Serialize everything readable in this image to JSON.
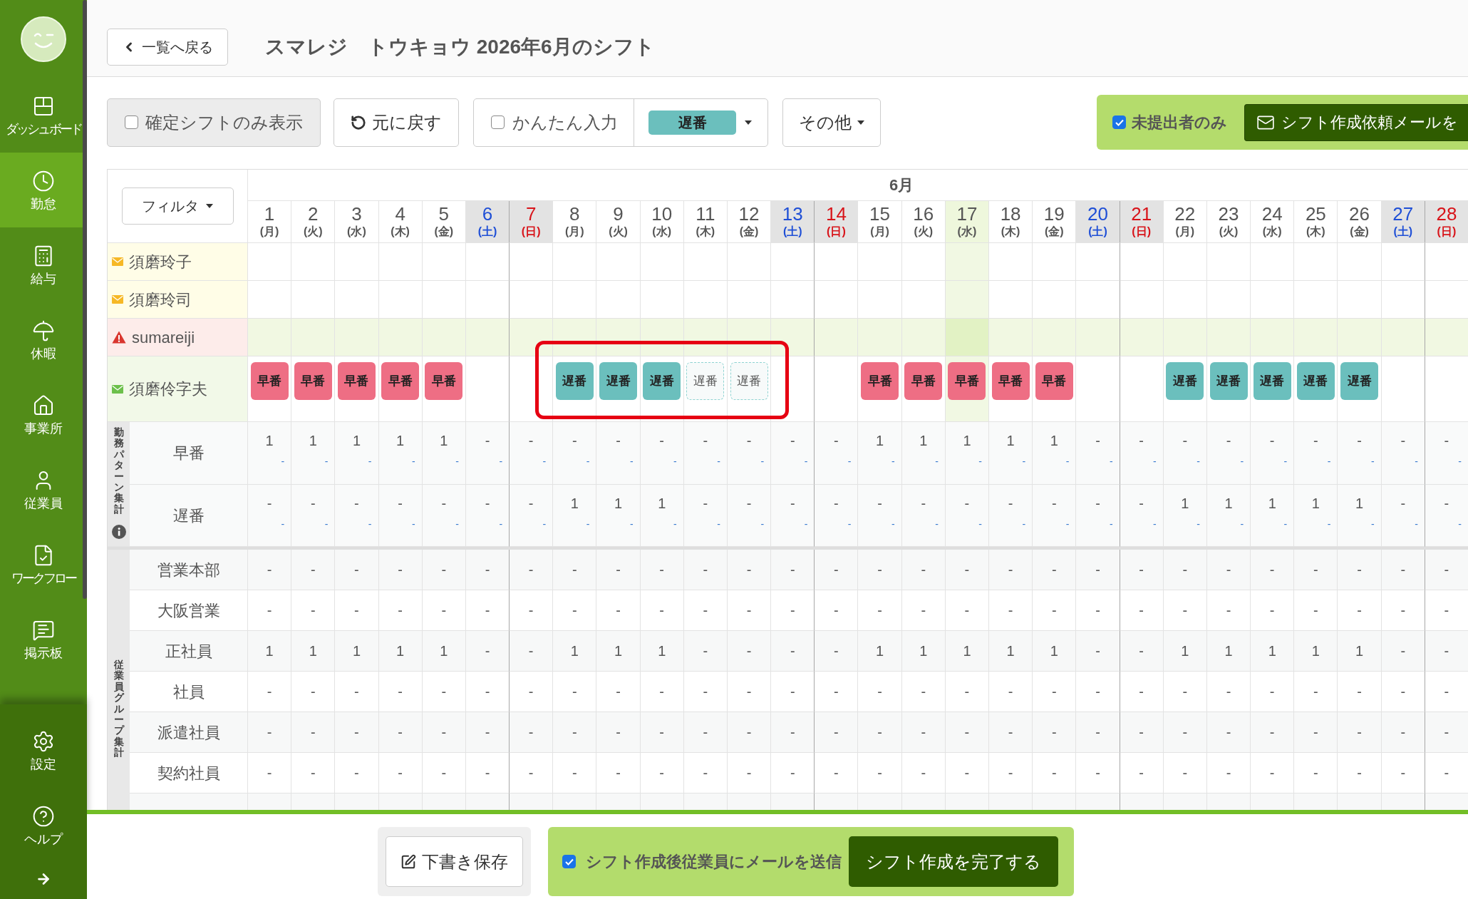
{
  "sidebar": {
    "items": [
      {
        "label": "ダッシュボード",
        "selected": false
      },
      {
        "label": "勤怠",
        "selected": true
      },
      {
        "label": "給与",
        "selected": false
      },
      {
        "label": "休暇",
        "selected": false
      },
      {
        "label": "事業所",
        "selected": false
      },
      {
        "label": "従業員",
        "selected": false
      },
      {
        "label": "ワークフロー",
        "selected": false
      },
      {
        "label": "掲示板",
        "selected": false
      }
    ],
    "bottom_items": [
      "設定",
      "ヘルプ"
    ]
  },
  "header": {
    "back_button": "一覧へ戻る",
    "title": "スマレジ　トウキョウ 2026年6月のシフト"
  },
  "toolbar": {
    "confirmed_only": {
      "label": "確定シフトのみ表示",
      "checked": false
    },
    "undo_button": "元に戻す",
    "quick_input": {
      "label": "かんたん入力",
      "checked": false,
      "pattern": "遅番"
    },
    "other_menu": "その他",
    "unsubmitted_only": {
      "label": "未提出者のみ",
      "checked": true
    },
    "request_mail_button": "シフト作成依頼メールを"
  },
  "calendar": {
    "filter_button": "フィルタ",
    "month": "6月",
    "days": [
      {
        "date": "1",
        "weekday": "(月)",
        "kind": "weekday",
        "today": false
      },
      {
        "date": "2",
        "weekday": "(火)",
        "kind": "weekday",
        "today": false
      },
      {
        "date": "3",
        "weekday": "(水)",
        "kind": "weekday",
        "today": false
      },
      {
        "date": "4",
        "weekday": "(木)",
        "kind": "weekday",
        "today": false
      },
      {
        "date": "5",
        "weekday": "(金)",
        "kind": "weekday",
        "today": false
      },
      {
        "date": "6",
        "weekday": "(土)",
        "kind": "saturday",
        "today": false
      },
      {
        "date": "7",
        "weekday": "(日)",
        "kind": "sunday",
        "today": false
      },
      {
        "date": "8",
        "weekday": "(月)",
        "kind": "weekday",
        "today": false
      },
      {
        "date": "9",
        "weekday": "(火)",
        "kind": "weekday",
        "today": false
      },
      {
        "date": "10",
        "weekday": "(水)",
        "kind": "weekday",
        "today": false
      },
      {
        "date": "11",
        "weekday": "(木)",
        "kind": "weekday",
        "today": false
      },
      {
        "date": "12",
        "weekday": "(金)",
        "kind": "weekday",
        "today": false
      },
      {
        "date": "13",
        "weekday": "(土)",
        "kind": "saturday",
        "today": false
      },
      {
        "date": "14",
        "weekday": "(日)",
        "kind": "sunday",
        "today": false
      },
      {
        "date": "15",
        "weekday": "(月)",
        "kind": "weekday",
        "today": false
      },
      {
        "date": "16",
        "weekday": "(火)",
        "kind": "weekday",
        "today": false
      },
      {
        "date": "17",
        "weekday": "(水)",
        "kind": "weekday",
        "today": true
      },
      {
        "date": "18",
        "weekday": "(木)",
        "kind": "weekday",
        "today": false
      },
      {
        "date": "19",
        "weekday": "(金)",
        "kind": "weekday",
        "today": false
      },
      {
        "date": "20",
        "weekday": "(土)",
        "kind": "saturday",
        "today": false
      },
      {
        "date": "21",
        "weekday": "(日)",
        "kind": "sunday",
        "today": false
      },
      {
        "date": "22",
        "weekday": "(月)",
        "kind": "weekday",
        "today": false
      },
      {
        "date": "23",
        "weekday": "(火)",
        "kind": "weekday",
        "today": false
      },
      {
        "date": "24",
        "weekday": "(水)",
        "kind": "weekday",
        "today": false
      },
      {
        "date": "25",
        "weekday": "(木)",
        "kind": "weekday",
        "today": false
      },
      {
        "date": "26",
        "weekday": "(金)",
        "kind": "weekday",
        "today": false
      },
      {
        "date": "27",
        "weekday": "(土)",
        "kind": "saturday",
        "today": false
      },
      {
        "date": "28",
        "weekday": "(日)",
        "kind": "sunday",
        "today": false
      }
    ],
    "employees": [
      {
        "name": "須磨玲子",
        "kind": "mail_pending",
        "selected": false
      },
      {
        "name": "須磨玲司",
        "kind": "mail_pending",
        "selected": false
      },
      {
        "name": "sumareiji",
        "kind": "warning",
        "selected": true
      },
      {
        "name": "須磨伶字夫",
        "kind": "mail_sent",
        "selected": false,
        "annotation": {
          "kind": "frame"
        },
        "shifts": [
          {
            "kind": "confirmed",
            "label": "早番",
            "color": "#ee6e84"
          },
          {
            "kind": "confirmed",
            "label": "早番",
            "color": "#ee6e84"
          },
          {
            "kind": "confirmed",
            "label": "早番",
            "color": "#ee6e84"
          },
          {
            "kind": "confirmed",
            "label": "早番",
            "color": "#ee6e84"
          },
          {
            "kind": "confirmed",
            "label": "早番",
            "color": "#ee6e84"
          },
          {
            "kind": "none"
          },
          {
            "kind": "none"
          },
          {
            "kind": "confirmed",
            "label": "遅番",
            "color": "#6bbfbd"
          },
          {
            "kind": "confirmed",
            "label": "遅番",
            "color": "#6bbfbd"
          },
          {
            "kind": "confirmed",
            "label": "遅番",
            "color": "#6bbfbd"
          },
          {
            "kind": "draft",
            "label": "遅番",
            "color": "#8fd3d1"
          },
          {
            "kind": "draft",
            "label": "遅番",
            "color": "#8fd3d1"
          },
          {
            "kind": "none"
          },
          {
            "kind": "none"
          },
          {
            "kind": "confirmed",
            "label": "早番",
            "color": "#ee6e84"
          },
          {
            "kind": "confirmed",
            "label": "早番",
            "color": "#ee6e84"
          },
          {
            "kind": "confirmed",
            "label": "早番",
            "color": "#ee6e84"
          },
          {
            "kind": "confirmed",
            "label": "早番",
            "color": "#ee6e84"
          },
          {
            "kind": "confirmed",
            "label": "早番",
            "color": "#ee6e84"
          },
          {
            "kind": "none"
          },
          {
            "kind": "none"
          },
          {
            "kind": "confirmed",
            "label": "遅番",
            "color": "#6bbfbd"
          },
          {
            "kind": "confirmed",
            "label": "遅番",
            "color": "#6bbfbd"
          },
          {
            "kind": "confirmed",
            "label": "遅番",
            "color": "#6bbfbd"
          },
          {
            "kind": "confirmed",
            "label": "遅番",
            "color": "#6bbfbd"
          },
          {
            "kind": "confirmed",
            "label": "遅番",
            "color": "#6bbfbd"
          },
          {
            "kind": "none"
          },
          {
            "kind": "none"
          }
        ]
      }
    ],
    "pattern_summary": {
      "label": "勤務パターン集計",
      "rows": [
        {
          "name": "早番",
          "values": [
            {
              "main": "1",
              "sub": "-"
            },
            {
              "main": "1",
              "sub": "-"
            },
            {
              "main": "1",
              "sub": "-"
            },
            {
              "main": "1",
              "sub": "-"
            },
            {
              "main": "1",
              "sub": "-"
            },
            {
              "main": "-",
              "sub": "-"
            },
            {
              "main": "-",
              "sub": "-"
            },
            {
              "main": "-",
              "sub": "-"
            },
            {
              "main": "-",
              "sub": "-"
            },
            {
              "main": "-",
              "sub": "-"
            },
            {
              "main": "-",
              "sub": "-"
            },
            {
              "main": "-",
              "sub": "-"
            },
            {
              "main": "-",
              "sub": "-"
            },
            {
              "main": "-",
              "sub": "-"
            },
            {
              "main": "1",
              "sub": "-"
            },
            {
              "main": "1",
              "sub": "-"
            },
            {
              "main": "1",
              "sub": "-"
            },
            {
              "main": "1",
              "sub": "-"
            },
            {
              "main": "1",
              "sub": "-"
            },
            {
              "main": "-",
              "sub": "-"
            },
            {
              "main": "-",
              "sub": "-"
            },
            {
              "main": "-",
              "sub": "-"
            },
            {
              "main": "-",
              "sub": "-"
            },
            {
              "main": "-",
              "sub": "-"
            },
            {
              "main": "-",
              "sub": "-"
            },
            {
              "main": "-",
              "sub": "-"
            },
            {
              "main": "-",
              "sub": "-"
            },
            {
              "main": "-",
              "sub": "-"
            }
          ]
        },
        {
          "name": "遅番",
          "values": [
            {
              "main": "-",
              "sub": "-"
            },
            {
              "main": "-",
              "sub": "-"
            },
            {
              "main": "-",
              "sub": "-"
            },
            {
              "main": "-",
              "sub": "-"
            },
            {
              "main": "-",
              "sub": "-"
            },
            {
              "main": "-",
              "sub": "-"
            },
            {
              "main": "-",
              "sub": "-"
            },
            {
              "main": "1",
              "sub": "-"
            },
            {
              "main": "1",
              "sub": "-"
            },
            {
              "main": "1",
              "sub": "-"
            },
            {
              "main": "-",
              "sub": "-"
            },
            {
              "main": "-",
              "sub": "-"
            },
            {
              "main": "-",
              "sub": "-"
            },
            {
              "main": "-",
              "sub": "-"
            },
            {
              "main": "-",
              "sub": "-"
            },
            {
              "main": "-",
              "sub": "-"
            },
            {
              "main": "-",
              "sub": "-"
            },
            {
              "main": "-",
              "sub": "-"
            },
            {
              "main": "-",
              "sub": "-"
            },
            {
              "main": "-",
              "sub": "-"
            },
            {
              "main": "-",
              "sub": "-"
            },
            {
              "main": "1",
              "sub": "-"
            },
            {
              "main": "1",
              "sub": "-"
            },
            {
              "main": "1",
              "sub": "-"
            },
            {
              "main": "1",
              "sub": "-"
            },
            {
              "main": "1",
              "sub": "-"
            },
            {
              "main": "-",
              "sub": "-"
            },
            {
              "main": "-",
              "sub": "-"
            }
          ]
        }
      ]
    },
    "group_summary": {
      "label": "従業員グループ集計",
      "rows": [
        {
          "name": "営業本部",
          "values": [
            "-",
            "-",
            "-",
            "-",
            "-",
            "-",
            "-",
            "-",
            "-",
            "-",
            "-",
            "-",
            "-",
            "-",
            "-",
            "-",
            "-",
            "-",
            "-",
            "-",
            "-",
            "-",
            "-",
            "-",
            "-",
            "-",
            "-",
            "-"
          ]
        },
        {
          "name": "大阪営業",
          "values": [
            "-",
            "-",
            "-",
            "-",
            "-",
            "-",
            "-",
            "-",
            "-",
            "-",
            "-",
            "-",
            "-",
            "-",
            "-",
            "-",
            "-",
            "-",
            "-",
            "-",
            "-",
            "-",
            "-",
            "-",
            "-",
            "-",
            "-",
            "-"
          ]
        },
        {
          "name": "正社員",
          "values": [
            "1",
            "1",
            "1",
            "1",
            "1",
            "-",
            "-",
            "1",
            "1",
            "1",
            "-",
            "-",
            "-",
            "-",
            "1",
            "1",
            "1",
            "1",
            "1",
            "-",
            "-",
            "1",
            "1",
            "1",
            "1",
            "1",
            "-",
            "-"
          ]
        },
        {
          "name": "社員",
          "values": [
            "-",
            "-",
            "-",
            "-",
            "-",
            "-",
            "-",
            "-",
            "-",
            "-",
            "-",
            "-",
            "-",
            "-",
            "-",
            "-",
            "-",
            "-",
            "-",
            "-",
            "-",
            "-",
            "-",
            "-",
            "-",
            "-",
            "-",
            "-"
          ]
        },
        {
          "name": "派遣社員",
          "values": [
            "-",
            "-",
            "-",
            "-",
            "-",
            "-",
            "-",
            "-",
            "-",
            "-",
            "-",
            "-",
            "-",
            "-",
            "-",
            "-",
            "-",
            "-",
            "-",
            "-",
            "-",
            "-",
            "-",
            "-",
            "-",
            "-",
            "-",
            "-"
          ]
        },
        {
          "name": "契約社員",
          "values": [
            "-",
            "-",
            "-",
            "-",
            "-",
            "-",
            "-",
            "-",
            "-",
            "-",
            "-",
            "-",
            "-",
            "-",
            "-",
            "-",
            "-",
            "-",
            "-",
            "-",
            "-",
            "-",
            "-",
            "-",
            "-",
            "-",
            "-",
            "-"
          ]
        }
      ]
    }
  },
  "footer": {
    "save_draft_button": "下書き保存",
    "send_mail": {
      "label": "シフト作成後従業員にメールを送信",
      "checked": true
    },
    "complete_button": "シフト作成を完了する"
  }
}
